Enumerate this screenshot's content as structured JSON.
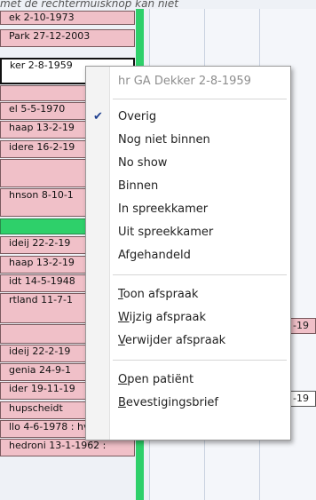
{
  "caption": "met de rechtermuisknop kan niet",
  "appointments": [
    {
      "text": "ek 2-10-1973"
    },
    {
      "text": "Park 27-12-2003"
    },
    {
      "text": "ker 2-8-1959"
    },
    {
      "text": ""
    },
    {
      "text": "el 5-5-1970"
    },
    {
      "text": "haap 13-2-19"
    },
    {
      "text": "idere 16-2-19"
    },
    {
      "text": ""
    },
    {
      "text": "hnson 8-10-1"
    },
    {
      "text": ""
    },
    {
      "text": "ideij 22-2-19"
    },
    {
      "text": "haap 13-2-19"
    },
    {
      "text": "idt 14-5-1948"
    },
    {
      "text": "rtland 11-7-1"
    },
    {
      "text": ""
    },
    {
      "text": "ideij 22-2-19"
    },
    {
      "text": "genia 24-9-1"
    },
    {
      "text": "ider 19-11-19"
    },
    {
      "text": "hupscheidt"
    },
    {
      "text": "llo 4-6-1978 : hv"
    },
    {
      "text": "hedroni 13-1-1962 :"
    }
  ],
  "right_appointments": [
    {
      "text": "-19"
    },
    {
      "text": "-19"
    }
  ],
  "menu": {
    "header": "hr GA Dekker 2-8-1959",
    "status_items": [
      {
        "label": "Overig",
        "checked": true
      },
      {
        "label": "Nog niet binnen",
        "checked": false
      },
      {
        "label": "No show",
        "checked": false
      },
      {
        "label": "Binnen",
        "checked": false
      },
      {
        "label": "In spreekkamer",
        "checked": false
      },
      {
        "label": "Uit spreekkamer",
        "checked": false
      },
      {
        "label": "Afgehandeld",
        "checked": false
      }
    ],
    "action_items": [
      {
        "accel": "T",
        "rest": "oon afspraak"
      },
      {
        "accel": "W",
        "rest": "ijzig afspraak"
      },
      {
        "accel": "V",
        "rest": "erwijder afspraak"
      }
    ],
    "patient_items": [
      {
        "accel": "O",
        "rest": "pen patiënt"
      },
      {
        "accel": "B",
        "rest": "evestigingsbrief"
      }
    ],
    "check_glyph": "✔"
  }
}
